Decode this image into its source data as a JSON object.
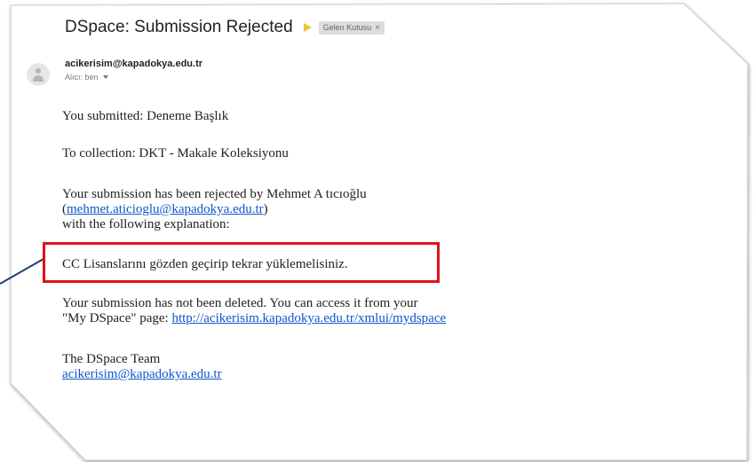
{
  "email": {
    "subject": "DSpace: Submission Rejected",
    "label": "Gelen Kutusu",
    "label_close": "×",
    "sender": "acikerisim@kapadokya.edu.tr",
    "recipient": "Alıcı: ben",
    "body": {
      "submitted": "You submitted: Deneme Başlık",
      "collection": "To collection: DKT - Makale Koleksiyonu",
      "rejected_by": "Your submission has been rejected by Mehmet A tıcıoğlu",
      "reviewer_open_paren": "(",
      "reviewer_email": "mehmet.aticioglu@kapadokya.edu.tr",
      "reviewer_close_paren": ")",
      "explanation_intro": "with the following explanation:",
      "explanation": "CC Lisanslarını gözden geçirip tekrar yüklemelisiniz.",
      "not_deleted": "Your submission has not been deleted.  You can access it from your",
      "mydspace_prefix": "\"My DSpace\" page: ",
      "mydspace_link": "http://acikerisim.kapadokya.edu.tr/xmlui/mydspace",
      "signature": "The DSpace Team",
      "signature_email": "acikerisim@kapadokya.edu.tr"
    }
  },
  "colors": {
    "highlight": "#e3101b",
    "pointer_line": "#1f3f73",
    "link": "#1155cc",
    "importance": "#f2c530"
  }
}
